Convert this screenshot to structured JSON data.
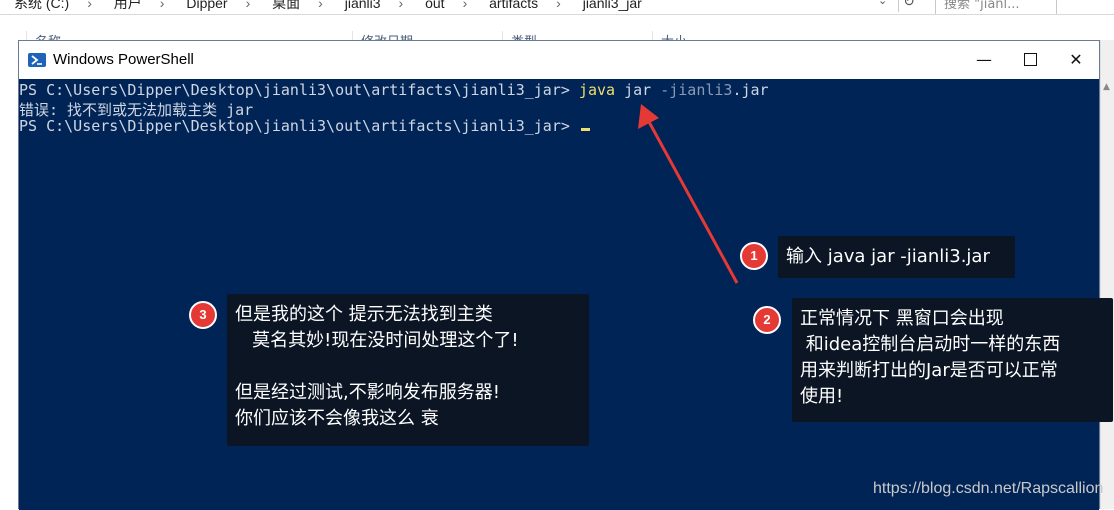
{
  "explorer": {
    "breadcrumb": [
      "系统 (C:)",
      "用户",
      "Dipper",
      "桌面",
      "jianli3",
      "out",
      "artifacts",
      "jianli3_jar"
    ],
    "search_placeholder": "搜索 \"jianl...",
    "columns": [
      "名称",
      "修改日期",
      "类型",
      "大小"
    ]
  },
  "window": {
    "title": "Windows PowerShell",
    "minimize": "—",
    "close": "✕"
  },
  "console": {
    "line1_prompt": "PS C:\\Users\\Dipper\\Desktop\\jianli3\\out\\artifacts\\jianli3_jar> ",
    "line1_cmd": "java",
    "line1_arg": " jar ",
    "line1_opt": "-jianli3",
    "line1_ext": ".jar",
    "line2": "错误: 找不到或无法加载主类 jar",
    "line3_prompt": "PS C:\\Users\\Dipper\\Desktop\\jianli3\\out\\artifacts\\jianli3_jar> "
  },
  "callouts": {
    "c1_num": "1",
    "c1_text": "输入 java jar -jianli3.jar",
    "c2_num": "2",
    "c2_text": "正常情况下 黑窗口会出现\n 和idea控制台启动时一样的东西\n用来判断打出的Jar是否可以正常\n使用!",
    "c3_num": "3",
    "c3_text": "但是我的这个 提示无法找到主类\n   莫名其妙!现在没时间处理这个了!\n\n但是经过测试,不影响发布服务器!\n你们应该不会像我这么 衰"
  },
  "watermark": "https://blog.csdn.net/Rapscallion",
  "colors": {
    "console_bg": "#012456",
    "prompt_text": "#cfd6e3",
    "command": "#f1dd6b",
    "badge_red": "#e53935",
    "callout_bg": "#0b1524",
    "arrow_red": "#e53935"
  },
  "icons": [
    "chevron-down-icon",
    "refresh-icon",
    "powershell-icon",
    "minimize-icon",
    "maximize-icon",
    "close-icon",
    "scroll-up-icon"
  ]
}
